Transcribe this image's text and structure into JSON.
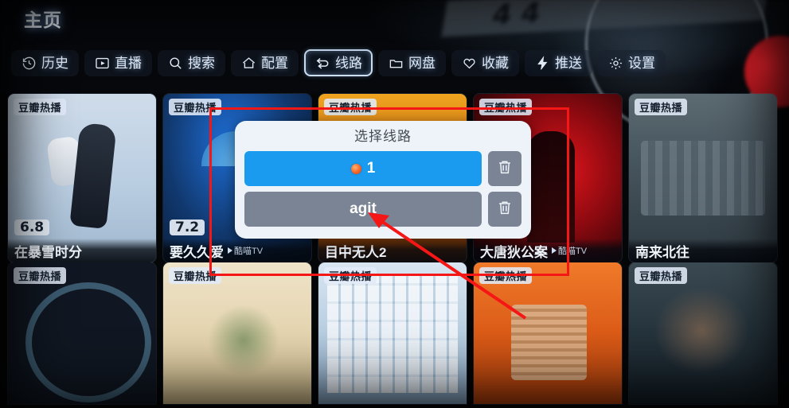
{
  "header": {
    "title": "主页"
  },
  "nav": {
    "items": [
      {
        "label": "历史",
        "icon": "history-icon",
        "selected": false
      },
      {
        "label": "直播",
        "icon": "live-tv-icon",
        "selected": false
      },
      {
        "label": "搜索",
        "icon": "search-icon",
        "selected": false
      },
      {
        "label": "配置",
        "icon": "home-config-icon",
        "selected": false
      },
      {
        "label": "线路",
        "icon": "route-swap-icon",
        "selected": true
      },
      {
        "label": "网盘",
        "icon": "folder-icon",
        "selected": false
      },
      {
        "label": "收藏",
        "icon": "heart-icon",
        "selected": false
      },
      {
        "label": "推送",
        "icon": "lightning-icon",
        "selected": false
      },
      {
        "label": "设置",
        "icon": "gear-icon",
        "selected": false
      }
    ]
  },
  "grid": {
    "row1": [
      {
        "badge": "豆瓣热播",
        "rating": "6.8",
        "title": "在暴雪时分",
        "source": ""
      },
      {
        "badge": "豆瓣热播",
        "rating": "7.2",
        "title": "要久久爱",
        "source": "酷喵TV"
      },
      {
        "badge": "豆瓣热播",
        "rating": "",
        "title": "目中无人2",
        "source": ""
      },
      {
        "badge": "豆瓣热播",
        "rating": "",
        "title": "大唐狄公案",
        "source": "酷喵TV"
      },
      {
        "badge": "豆瓣热播",
        "rating": "",
        "title": "南来北往",
        "source": ""
      }
    ],
    "row2": [
      {
        "badge": "豆瓣热播"
      },
      {
        "badge": "豆瓣热播"
      },
      {
        "badge": "豆瓣热播"
      },
      {
        "badge": "豆瓣热播"
      },
      {
        "badge": "豆瓣热播"
      }
    ]
  },
  "dialog": {
    "title": "选择线路",
    "routes": [
      {
        "label": "1",
        "selected": true,
        "has_dot": true,
        "delete_icon": "trash-icon"
      },
      {
        "label": "agit",
        "selected": false,
        "has_dot": false,
        "delete_icon": "trash-icon"
      }
    ]
  },
  "background": {
    "plate_digits": "4 4"
  },
  "colors": {
    "accent_blue": "#1a9bf0",
    "idle_gray": "#7b8494",
    "dialog_bg": "#eef3f9",
    "annotation_red": "#f51616",
    "dot_orange": "#f2642a"
  }
}
